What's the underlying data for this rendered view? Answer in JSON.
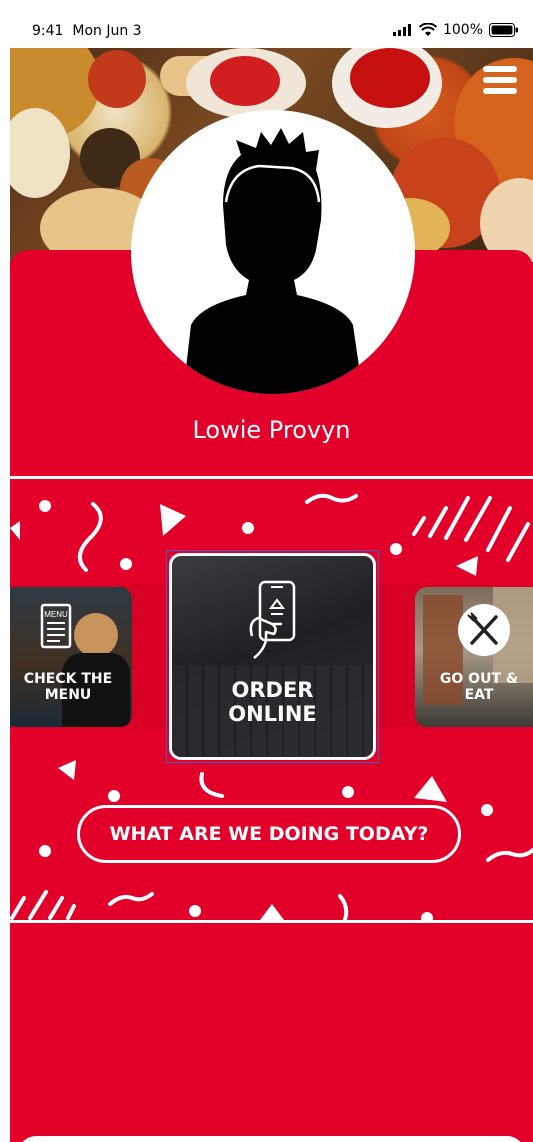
{
  "status_bar": {
    "time": "9:41",
    "date": "Mon Jun 3",
    "battery": "100%"
  },
  "profile": {
    "name": "Lowie Provyn"
  },
  "tiles": [
    {
      "label_line1": "CHECK THE",
      "label_line2": "MENU",
      "icon": "menu-card-icon"
    },
    {
      "label_line1": "ORDER",
      "label_line2": "ONLINE",
      "icon": "phone-order-icon"
    },
    {
      "label_line1": "GO OUT &",
      "label_line2": "EAT",
      "icon": "fork-knife-icon"
    }
  ],
  "cta": {
    "label": "WHAT ARE WE DOING TODAY?"
  },
  "colors": {
    "brand_red": "#e2002a",
    "white": "#ffffff",
    "selection_outline": "#3a64c8"
  }
}
